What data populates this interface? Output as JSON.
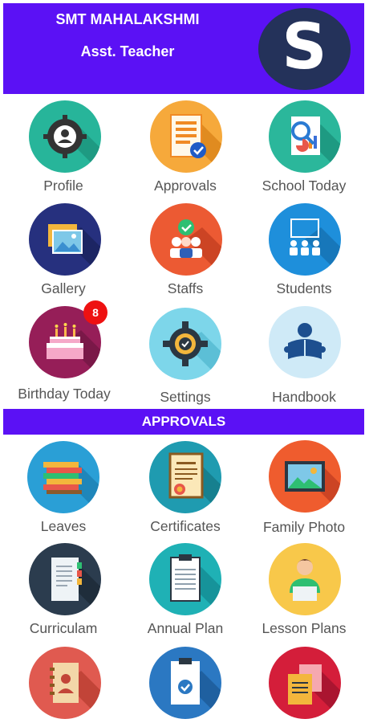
{
  "header": {
    "name": "SMT MAHALAKSHMI",
    "role": "Asst. Teacher",
    "logo_letter": "S"
  },
  "main_menu": {
    "profile": "Profile",
    "approvals": "Approvals",
    "school_today": "School Today",
    "gallery": "Gallery",
    "staffs": "Staffs",
    "students": "Students",
    "birthday_today": "Birthday Today",
    "birthday_count": "8",
    "settings": "Settings",
    "handbook": "Handbook"
  },
  "approvals_section": {
    "title": "APPROVALS",
    "leaves": "Leaves",
    "certificates": "Certificates",
    "family_photo": "Family Photo",
    "curriculam": "Curriculam",
    "annual_plan": "Annual Plan",
    "lesson_plans": "Lesson Plans"
  },
  "colors": {
    "header_bg": "#5b11f5",
    "badge": "#ee1111",
    "label_text": "#555555"
  }
}
